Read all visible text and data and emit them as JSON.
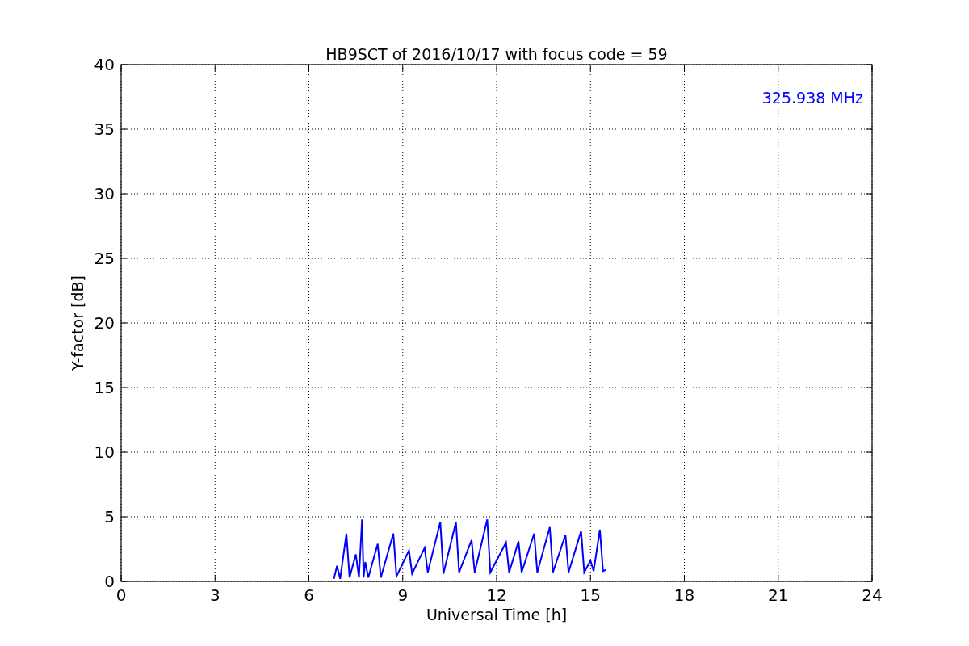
{
  "chart_data": {
    "type": "line",
    "title": "HB9SCT of 2016/10/17 with focus code = 59",
    "xlabel": "Universal Time [h]",
    "ylabel": "Y-factor [dB]",
    "x": [
      6.8,
      6.9,
      7.0,
      7.2,
      7.3,
      7.5,
      7.6,
      7.7,
      7.75,
      7.8,
      7.9,
      8.2,
      8.3,
      8.7,
      8.8,
      9.2,
      9.3,
      9.7,
      9.8,
      10.2,
      10.3,
      10.7,
      10.8,
      11.2,
      11.3,
      11.7,
      11.8,
      12.3,
      12.4,
      12.7,
      12.8,
      13.2,
      13.3,
      13.7,
      13.8,
      14.2,
      14.3,
      14.7,
      14.8,
      15.0,
      15.1,
      15.3,
      15.4,
      15.5
    ],
    "series": [
      {
        "color": "#0000ff",
        "values": [
          0.2,
          1.2,
          0.2,
          3.7,
          0.3,
          2.1,
          0.3,
          4.8,
          0.3,
          1.5,
          0.3,
          2.9,
          0.3,
          3.7,
          0.4,
          2.4,
          0.6,
          2.6,
          0.7,
          4.6,
          0.6,
          4.6,
          0.7,
          3.2,
          0.7,
          4.8,
          0.7,
          3.0,
          0.7,
          3.1,
          0.7,
          3.7,
          0.7,
          4.2,
          0.7,
          3.6,
          0.7,
          3.9,
          0.7,
          1.6,
          0.8,
          4.0,
          0.8,
          0.9
        ]
      }
    ],
    "xlim": [
      0,
      24
    ],
    "ylim": [
      0,
      40
    ],
    "xticks": [
      0,
      3,
      6,
      9,
      12,
      15,
      18,
      21,
      24
    ],
    "yticks": [
      0,
      5,
      10,
      15,
      20,
      25,
      30,
      35,
      40
    ],
    "grid": true,
    "annotations": [
      {
        "text": "325.938 MHz"
      }
    ]
  }
}
